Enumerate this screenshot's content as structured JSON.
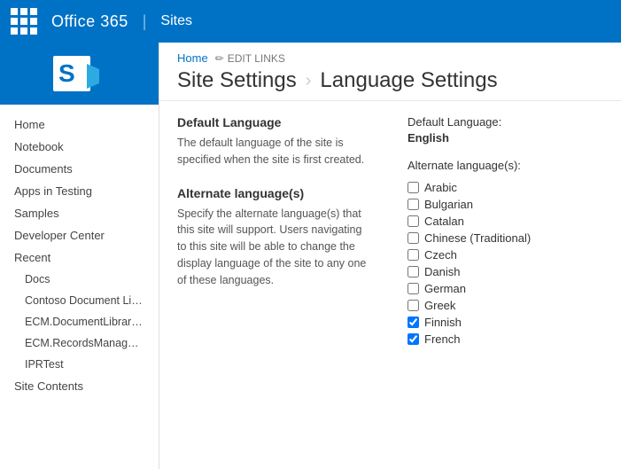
{
  "topbar": {
    "title": "Office 365",
    "divider": "|",
    "subtitle": "Sites"
  },
  "sidebar": {
    "logo_alt": "SharePoint",
    "nav_items": [
      {
        "label": "Home",
        "indent": false
      },
      {
        "label": "Notebook",
        "indent": false
      },
      {
        "label": "Documents",
        "indent": false
      },
      {
        "label": "Apps in Testing",
        "indent": false
      },
      {
        "label": "Samples",
        "indent": false
      },
      {
        "label": "Developer Center",
        "indent": false
      },
      {
        "label": "Recent",
        "indent": false,
        "is_section": true
      },
      {
        "label": "Docs",
        "indent": true
      },
      {
        "label": "Contoso Document Library",
        "indent": true
      },
      {
        "label": "ECM.DocumentLibraries",
        "indent": true
      },
      {
        "label": "ECM.RecordsManagement",
        "indent": true
      },
      {
        "label": "IPRTest",
        "indent": true
      },
      {
        "label": "Site Contents",
        "indent": false
      }
    ]
  },
  "breadcrumb": {
    "home": "Home",
    "edit_links": "EDIT LINKS"
  },
  "page": {
    "title_left": "Site Settings",
    "title_right": "Language Settings"
  },
  "default_language": {
    "section_title": "Default Language",
    "section_desc": "The default language of the site is specified when the site is first created.",
    "label": "Default Language:",
    "value": "English"
  },
  "alternate_languages": {
    "section_title": "Alternate language(s)",
    "section_desc": "Specify the alternate language(s) that this site will support. Users navigating to this site will be able to change the display language of the site to any one of these languages.",
    "label": "Alternate language(s):",
    "languages": [
      {
        "name": "Arabic",
        "checked": false
      },
      {
        "name": "Bulgarian",
        "checked": false
      },
      {
        "name": "Catalan",
        "checked": false
      },
      {
        "name": "Chinese (Traditional)",
        "checked": false
      },
      {
        "name": "Czech",
        "checked": false
      },
      {
        "name": "Danish",
        "checked": false
      },
      {
        "name": "German",
        "checked": false
      },
      {
        "name": "Greek",
        "checked": false
      },
      {
        "name": "Finnish",
        "checked": true
      },
      {
        "name": "French",
        "checked": true
      }
    ]
  }
}
